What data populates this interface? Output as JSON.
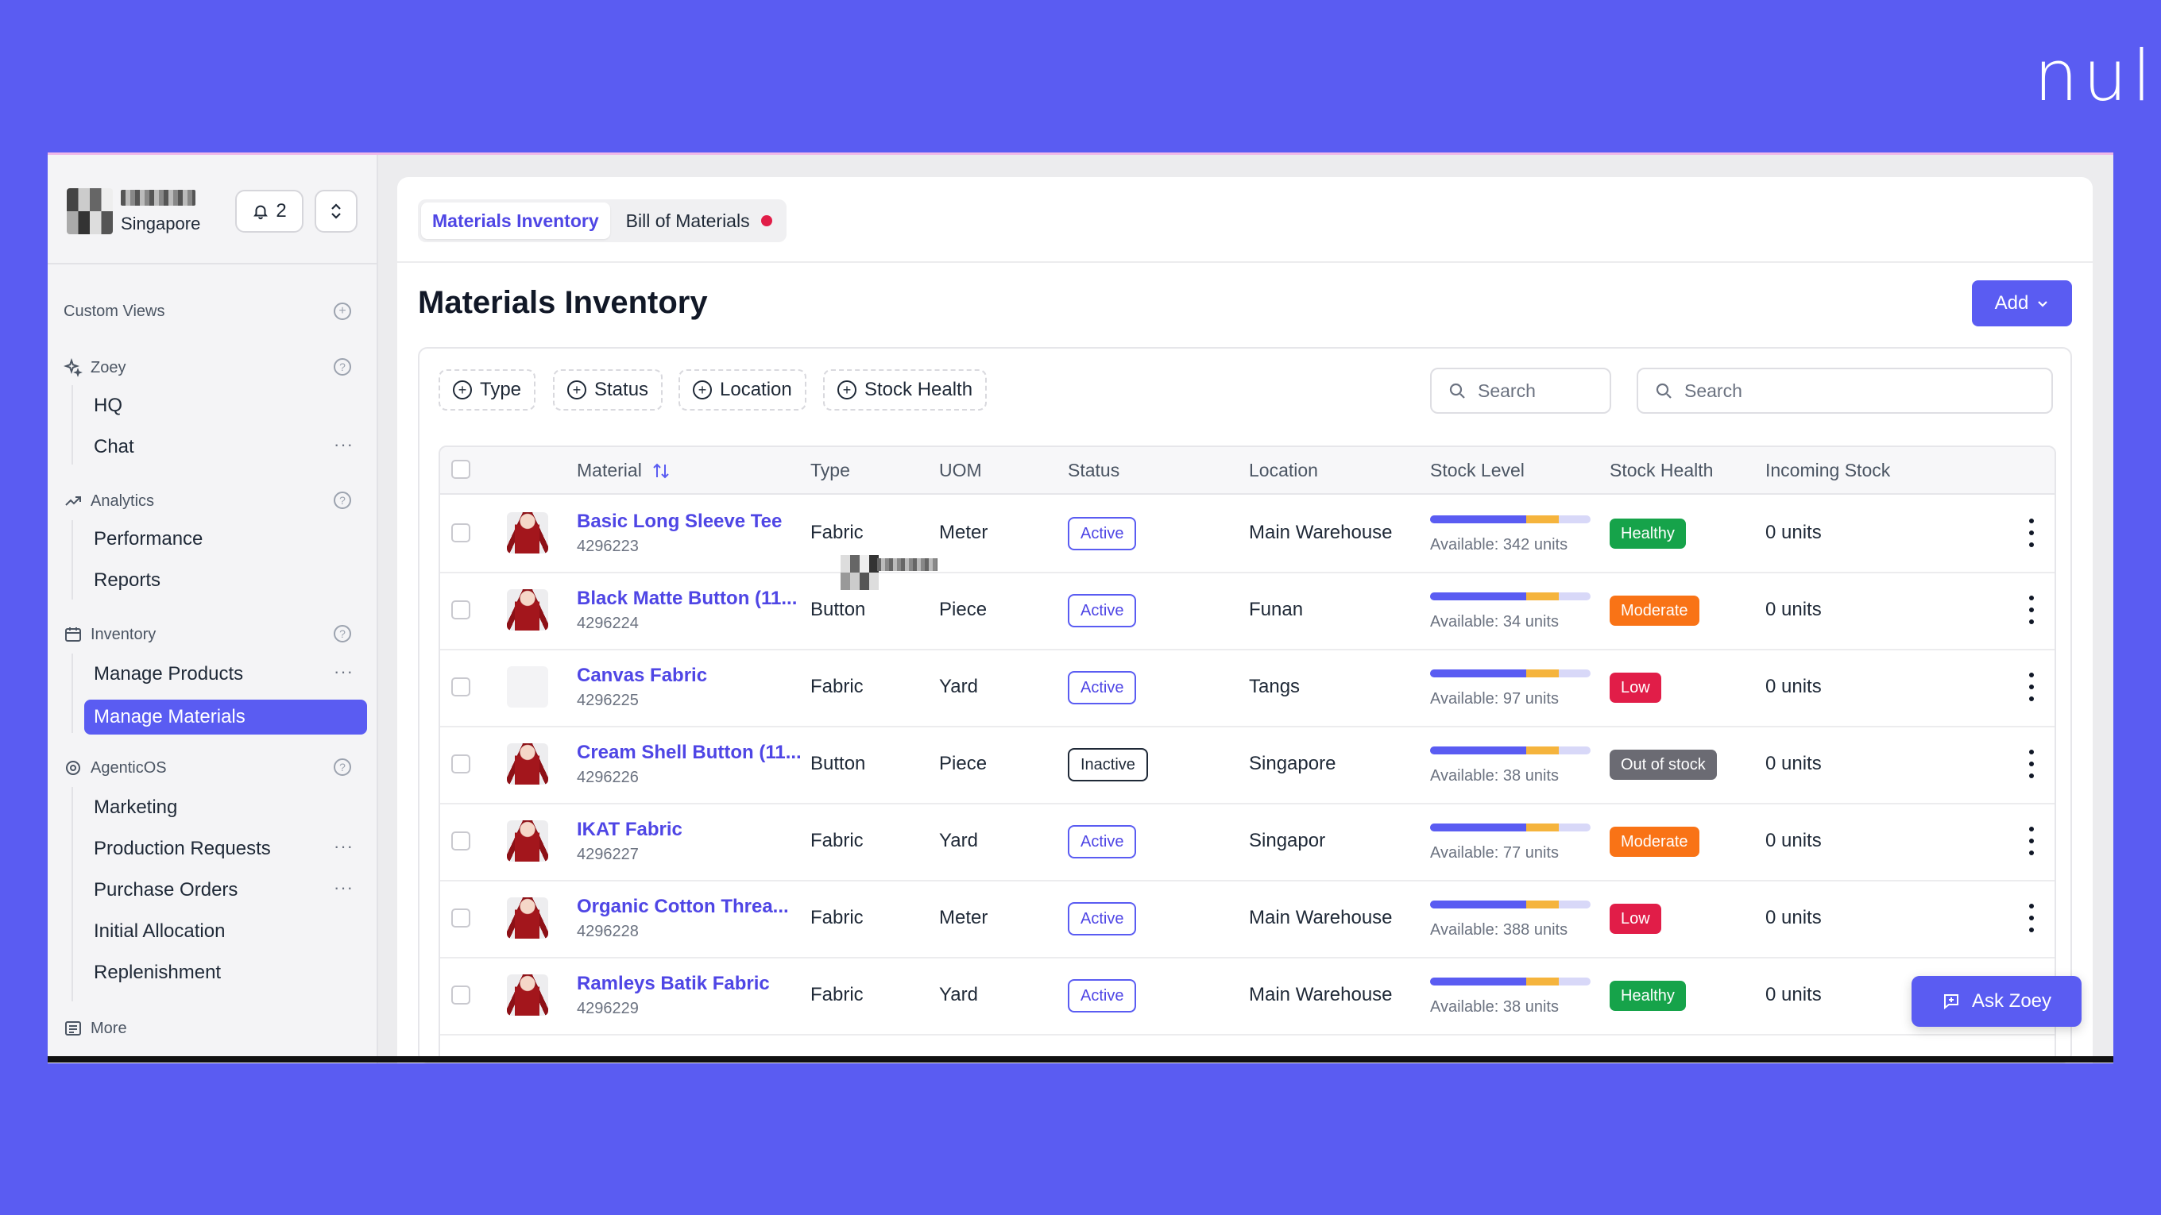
{
  "brand": {
    "logo_text": "nul"
  },
  "sidebar": {
    "org": {
      "city": "Singapore"
    },
    "notifications": {
      "count": "2"
    },
    "custom_views": "Custom Views",
    "sections": [
      {
        "label": "Zoey",
        "items": [
          "HQ",
          "Chat"
        ]
      },
      {
        "label": "Analytics",
        "items": [
          "Performance",
          "Reports"
        ]
      },
      {
        "label": "Inventory",
        "items": [
          "Manage Products",
          "Manage Materials"
        ]
      },
      {
        "label": "AgenticOS",
        "items": [
          "Marketing",
          "Production Requests",
          "Purchase Orders",
          "Initial Allocation",
          "Replenishment"
        ]
      }
    ],
    "more": "More",
    "active_item": "Manage Materials"
  },
  "tabs": [
    {
      "label": "Materials Inventory",
      "active": true
    },
    {
      "label": "Bill of Materials",
      "active": false
    }
  ],
  "page": {
    "title": "Materials Inventory",
    "add_label": "Add"
  },
  "filters": [
    "Type",
    "Status",
    "Location",
    "Stock Health"
  ],
  "search": {
    "placeholder_1": "Search",
    "placeholder_2": "Search"
  },
  "table": {
    "columns": [
      "Material",
      "Type",
      "UOM",
      "Status",
      "Location",
      "Stock Level",
      "Stock Health",
      "Incoming Stock"
    ],
    "rows": [
      {
        "name": "Basic Long Sleeve Tee",
        "id": "4296223",
        "type": "Fabric",
        "uom": "Meter",
        "status": "Active",
        "location": "Main Warehouse",
        "available": "Available: 342 units",
        "health": "Healthy",
        "incoming": "0 units"
      },
      {
        "name": "Black Matte Button (11...",
        "id": "4296224",
        "type": "Button",
        "uom": "Piece",
        "status": "Active",
        "location": "Funan",
        "available": "Available: 34 units",
        "health": "Moderate",
        "incoming": "0 units"
      },
      {
        "name": "Canvas Fabric",
        "id": "4296225",
        "type": "Fabric",
        "uom": "Yard",
        "status": "Active",
        "location": "Tangs",
        "available": "Available: 97 units",
        "health": "Low",
        "incoming": "0 units"
      },
      {
        "name": "Cream Shell Button (11...",
        "id": "4296226",
        "type": "Button",
        "uom": "Piece",
        "status": "Inactive",
        "location": "Singapore",
        "available": "Available: 38 units",
        "health": "Out of stock",
        "incoming": "0 units"
      },
      {
        "name": "IKAT Fabric",
        "id": "4296227",
        "type": "Fabric",
        "uom": "Yard",
        "status": "Active",
        "location": "Singapor",
        "available": "Available: 77 units",
        "health": "Moderate",
        "incoming": "0 units"
      },
      {
        "name": "Organic Cotton Threa...",
        "id": "4296228",
        "type": "Fabric",
        "uom": "Meter",
        "status": "Active",
        "location": "Main Warehouse",
        "available": "Available: 388 units",
        "health": "Low",
        "incoming": "0 units"
      },
      {
        "name": "Ramleys Batik Fabric",
        "id": "4296229",
        "type": "Fabric",
        "uom": "Yard",
        "status": "Active",
        "location": "Main Warehouse",
        "available": "Available: 38 units",
        "health": "Healthy",
        "incoming": "0 units"
      }
    ]
  },
  "colors": {
    "accent": "#5a5cf2",
    "healthy": "#16a34a",
    "moderate": "#f97316",
    "low": "#e11d48",
    "out_of_stock": "#6b6b73"
  },
  "ask_zoey": "Ask Zoey"
}
